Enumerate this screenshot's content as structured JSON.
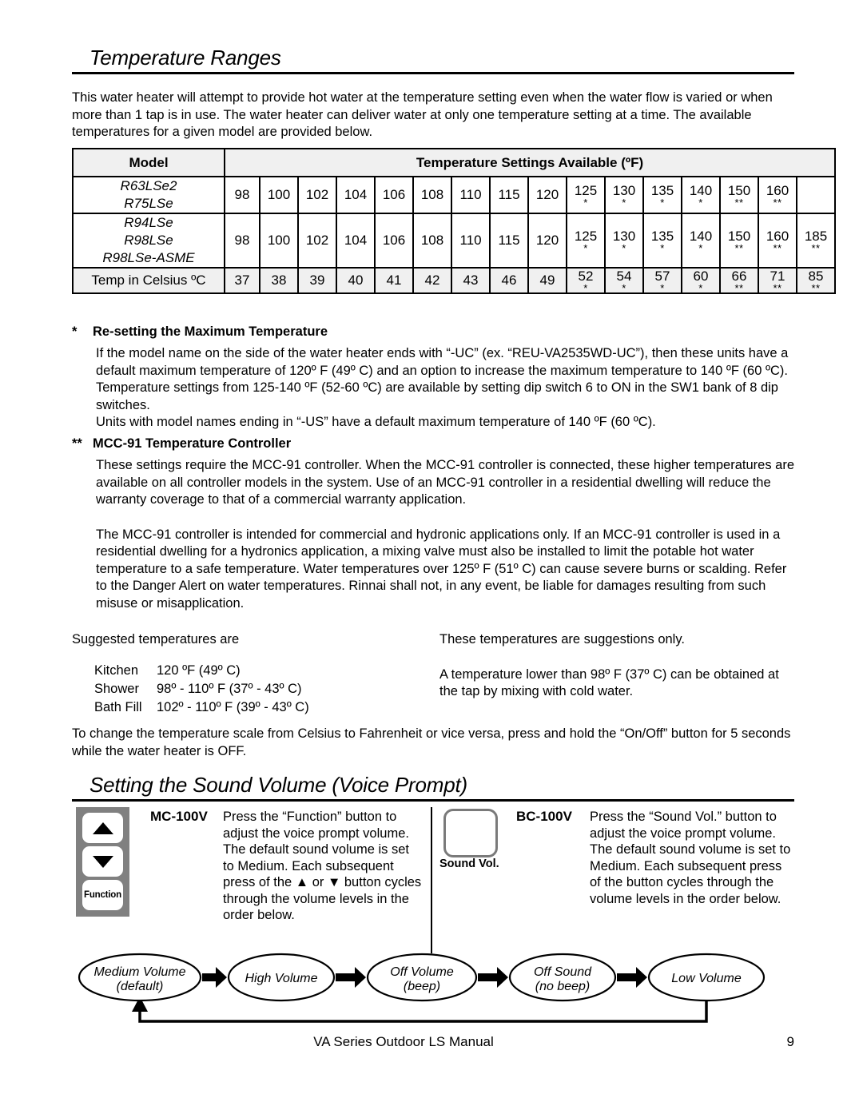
{
  "section1": {
    "heading": "Temperature Ranges",
    "intro": "This water heater will attempt to provide hot water at the temperature setting even when the water flow is varied or when more than 1 tap is in use.  The water heater can deliver water at only one temperature setting at a time. The available temperatures for a given model are provided below."
  },
  "table": {
    "header_model": "Model",
    "header_settings": "Temperature Settings Available (ºF)",
    "rows": [
      {
        "model_lines": [
          "R63LSe2",
          "R75LSe"
        ],
        "values": [
          "98",
          "100",
          "102",
          "104",
          "106",
          "108",
          "110",
          "115",
          "120",
          "125",
          "130",
          "135",
          "140",
          "150",
          "160",
          ""
        ],
        "marks": [
          "",
          "",
          "",
          "",
          "",
          "",
          "",
          "",
          "",
          "*",
          "*",
          "*",
          "*",
          "**",
          "**",
          ""
        ]
      },
      {
        "model_lines": [
          "R94LSe",
          "R98LSe",
          "R98LSe-ASME"
        ],
        "values": [
          "98",
          "100",
          "102",
          "104",
          "106",
          "108",
          "110",
          "115",
          "120",
          "125",
          "130",
          "135",
          "140",
          "150",
          "160",
          "185"
        ],
        "marks": [
          "",
          "",
          "",
          "",
          "",
          "",
          "",
          "",
          "",
          "*",
          "*",
          "*",
          "*",
          "**",
          "**",
          "**"
        ]
      },
      {
        "model_lines": [
          "Temp in Celsius  ºC"
        ],
        "values": [
          "37",
          "38",
          "39",
          "40",
          "41",
          "42",
          "43",
          "46",
          "49",
          "52",
          "54",
          "57",
          "60",
          "66",
          "71",
          "85"
        ],
        "marks": [
          "",
          "",
          "",
          "",
          "",
          "",
          "",
          "",
          "",
          "*",
          "*",
          "*",
          "*",
          "**",
          "**",
          "**"
        ]
      }
    ]
  },
  "note_star": {
    "mark": "*",
    "title": "Re-setting the Maximum Temperature",
    "p1": "If the model name on the side of the water heater ends with “-UC” (ex. “REU-VA2535WD-UC”), then these units have a default maximum temperature of 120º F (49º C) and an option to increase the maximum temperature to 140 ºF (60 ºC).  Temperature settings from 125-140 ºF (52-60 ºC) are available by setting dip switch 6 to ON in the SW1 bank of 8 dip switches.",
    "p2": "Units with model names ending in “-US” have a default maximum temperature of 140 ºF (60 ºC)."
  },
  "note_doublestar": {
    "mark": "**",
    "title": "MCC-91 Temperature Controller",
    "p1": "These settings require the MCC-91 controller.  When the MCC-91 controller is connected, these higher temperatures are available on all controller models in the system. Use of an MCC-91 controller in a residential dwelling will reduce the warranty coverage to that of a commercial warranty application.",
    "p2": "The MCC-91 controller is intended for commercial and hydronic applications only. If an MCC-91 controller is used in a residential dwelling for a hydronics application, a mixing valve must also be installed to limit the potable hot water temperature to a safe temperature. Water temperatures over 125º F (51º C) can cause severe burns or scalding. Refer to the Danger Alert on water temperatures. Rinnai shall not, in any event, be liable for damages resulting from such misuse or misapplication."
  },
  "suggested": {
    "left_title": "Suggested temperatures are",
    "items": [
      {
        "label": "Kitchen",
        "value": "120 ºF (49º C)"
      },
      {
        "label": "Shower",
        "value": "98º - 110º F (37º - 43º C)"
      },
      {
        "label": "Bath Fill",
        "value": "102º - 110º F (39º - 43º C)"
      }
    ],
    "right_p1": "These temperatures are suggestions only.",
    "right_p2": "A temperature lower than 98º F (37º C) can be obtained at the tap by mixing with cold water."
  },
  "scale_note": "To change the temperature scale from Celsius to Fahrenheit or vice versa, press and hold the “On/Off” button for 5 seconds while the water heater is OFF.",
  "section2": {
    "heading": "Setting the Sound Volume (Voice Prompt)",
    "mc": {
      "name": "MC-100V",
      "function_button_label": "Function",
      "text": "Press the “Function” button to adjust the voice prompt volume.  The default sound volume is set to Medium. Each subsequent press of the ▲ or ▼ button cycles through the volume levels in the order below."
    },
    "bc": {
      "name": "BC-100V",
      "button_label": "Sound Vol.",
      "text": "Press the “Sound Vol.” button to adjust the voice prompt volume. The default sound volume is set to Medium.  Each subsequent press of the button cycles through the volume levels in the order below."
    },
    "flow": {
      "nodes": [
        {
          "line1": "Medium Volume",
          "line2": "(default)"
        },
        {
          "line1": "High Volume",
          "line2": ""
        },
        {
          "line1": "Off Volume",
          "line2": "(beep)"
        },
        {
          "line1": "Off Sound",
          "line2": "(no beep)"
        },
        {
          "line1": "Low Volume",
          "line2": ""
        }
      ]
    }
  },
  "footer": {
    "title": "VA Series Outdoor LS Manual",
    "page": "9"
  }
}
